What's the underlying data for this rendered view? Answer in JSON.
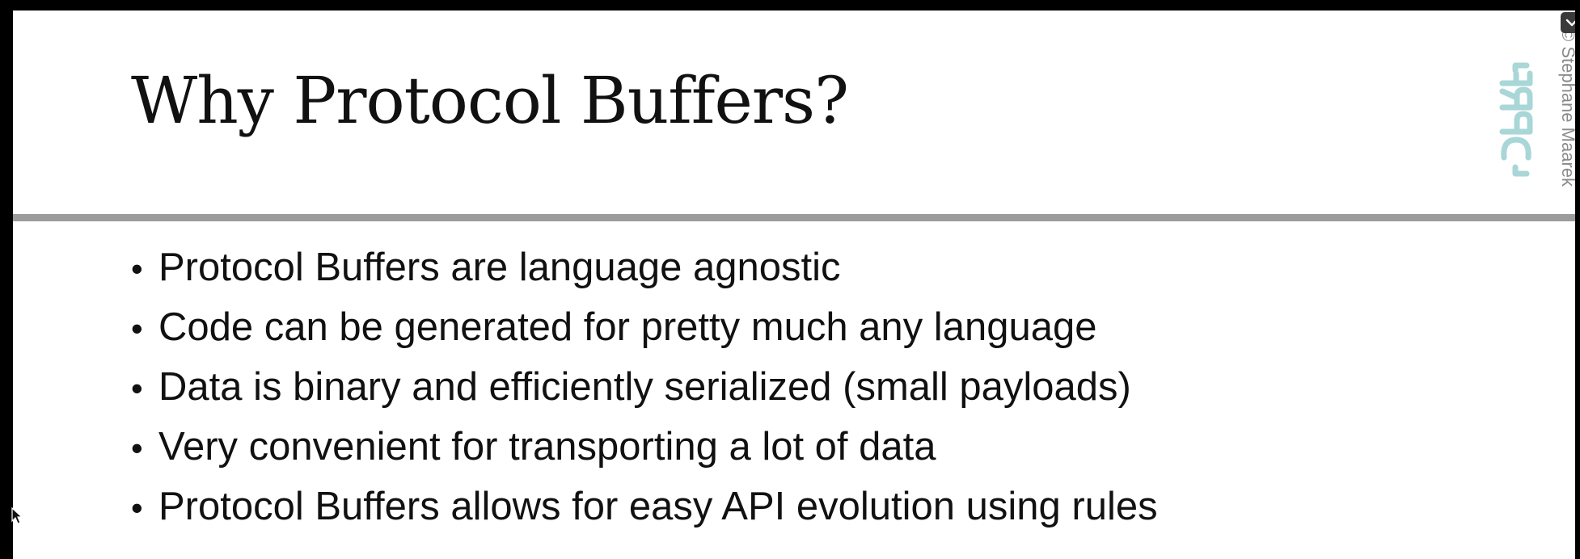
{
  "slide": {
    "title": "Why Protocol Buffers?",
    "bullet_symbol": "•",
    "bullets": [
      "Protocol Buffers are language agnostic",
      "Code can be generated for pretty much any language",
      "Data is binary and efficiently serialized (small payloads)",
      "Very convenient for transporting a lot of data",
      "Protocol Buffers allows for easy API evolution using rules"
    ],
    "logo": {
      "icon": "grpc-logo-icon",
      "text": "GRPC",
      "color": "#a9d6d6"
    },
    "copyright": "© Stephane Maarek",
    "rule_color": "#9c9c9c"
  },
  "controls": {
    "collapse_icon": "chevron-down-icon"
  }
}
